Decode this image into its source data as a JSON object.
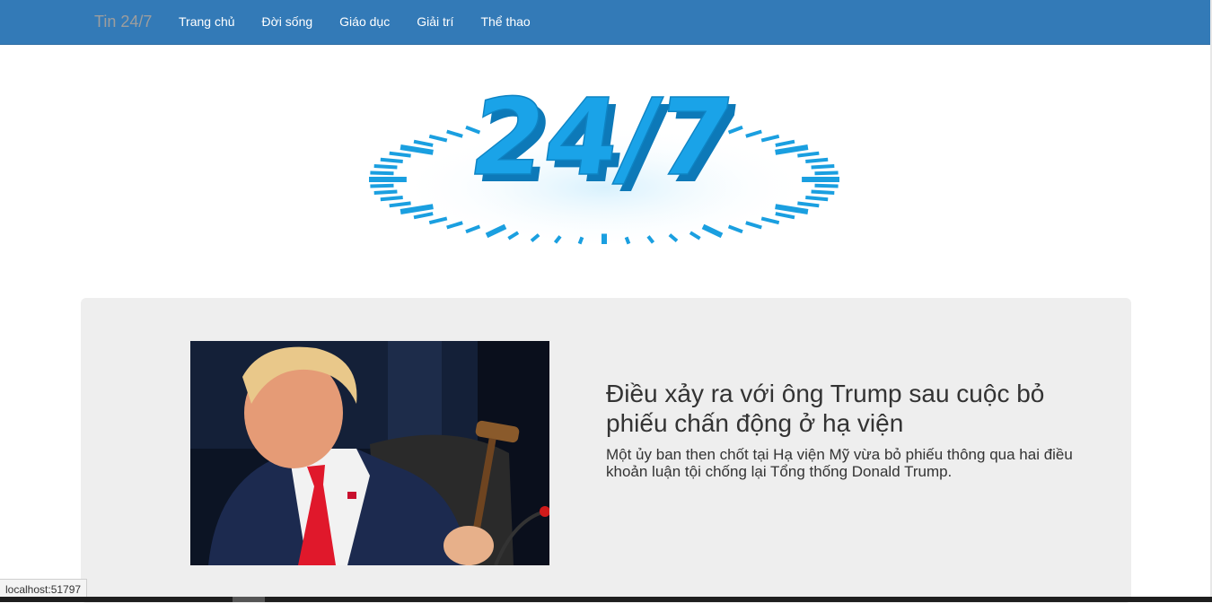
{
  "navbar": {
    "brand": "Tin 24/7",
    "items": [
      {
        "label": "Trang chủ"
      },
      {
        "label": "Đời sống"
      },
      {
        "label": "Giáo dục"
      },
      {
        "label": "Giải trí"
      },
      {
        "label": "Thể thao"
      }
    ]
  },
  "logo": {
    "text": "24/7"
  },
  "featured": {
    "title": "Điều xảy ra với ông Trump sau cuộc bỏ phiếu chấn động ở hạ viện",
    "summary": "Một ủy ban then chốt tại Hạ viện Mỹ vừa bỏ phiếu thông qua hai điều khoản luận tội chống lại Tổng thống Donald Trump."
  },
  "status_bar": {
    "url": "localhost:51797"
  },
  "colors": {
    "navbar": "#337ab7",
    "logo_blue": "#1aa3e8",
    "jumbotron": "#eeeeee"
  }
}
